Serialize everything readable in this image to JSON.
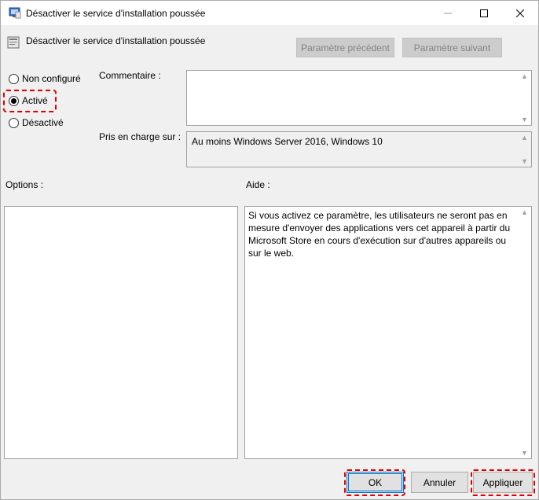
{
  "window": {
    "title": "Désactiver le service d'installation poussée"
  },
  "header": {
    "policy_name": "Désactiver le service d'installation poussée",
    "prev_button": "Paramètre précédent",
    "next_button": "Paramètre suivant"
  },
  "state": {
    "options": [
      {
        "label": "Non configuré",
        "selected": false
      },
      {
        "label": "Activé",
        "selected": true
      },
      {
        "label": "Désactivé",
        "selected": false
      }
    ]
  },
  "comment": {
    "label": "Commentaire :",
    "value": ""
  },
  "supported": {
    "label": "Pris en charge sur :",
    "value": "Au moins Windows Server 2016, Windows 10"
  },
  "options_panel": {
    "label": "Options :"
  },
  "help_panel": {
    "label": "Aide :",
    "text": "Si vous activez ce paramètre, les utilisateurs ne seront pas en mesure d'envoyer des applications vers cet appareil à partir du Microsoft Store en cours d'exécution sur d'autres appareils ou sur le web."
  },
  "footer": {
    "ok": "OK",
    "cancel": "Annuler",
    "apply": "Appliquer"
  },
  "colors": {
    "highlight": "#e00000",
    "focus": "#0078d7"
  }
}
